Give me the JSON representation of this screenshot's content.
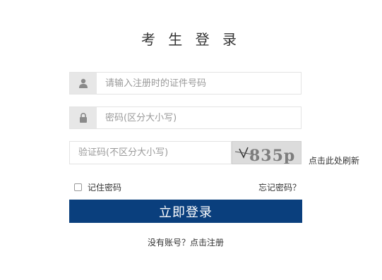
{
  "title": "考 生 登 录",
  "id_field": {
    "placeholder": "请输入注册时的证件号码",
    "icon": "user-icon"
  },
  "password_field": {
    "placeholder": "密码(区分大小写)",
    "icon": "lock-icon"
  },
  "captcha_field": {
    "placeholder": "验证码(不区分大小写)"
  },
  "captcha_image": {
    "text": "835p"
  },
  "refresh_label": "点击此处刷新",
  "remember_label": "记住密码",
  "forgot_label": "忘记密码？",
  "login_label": "立即登录",
  "register_label": "没有账号？点击注册",
  "colors": {
    "primary": "#0a3f7d",
    "addon_bg": "#e7e7e7"
  }
}
